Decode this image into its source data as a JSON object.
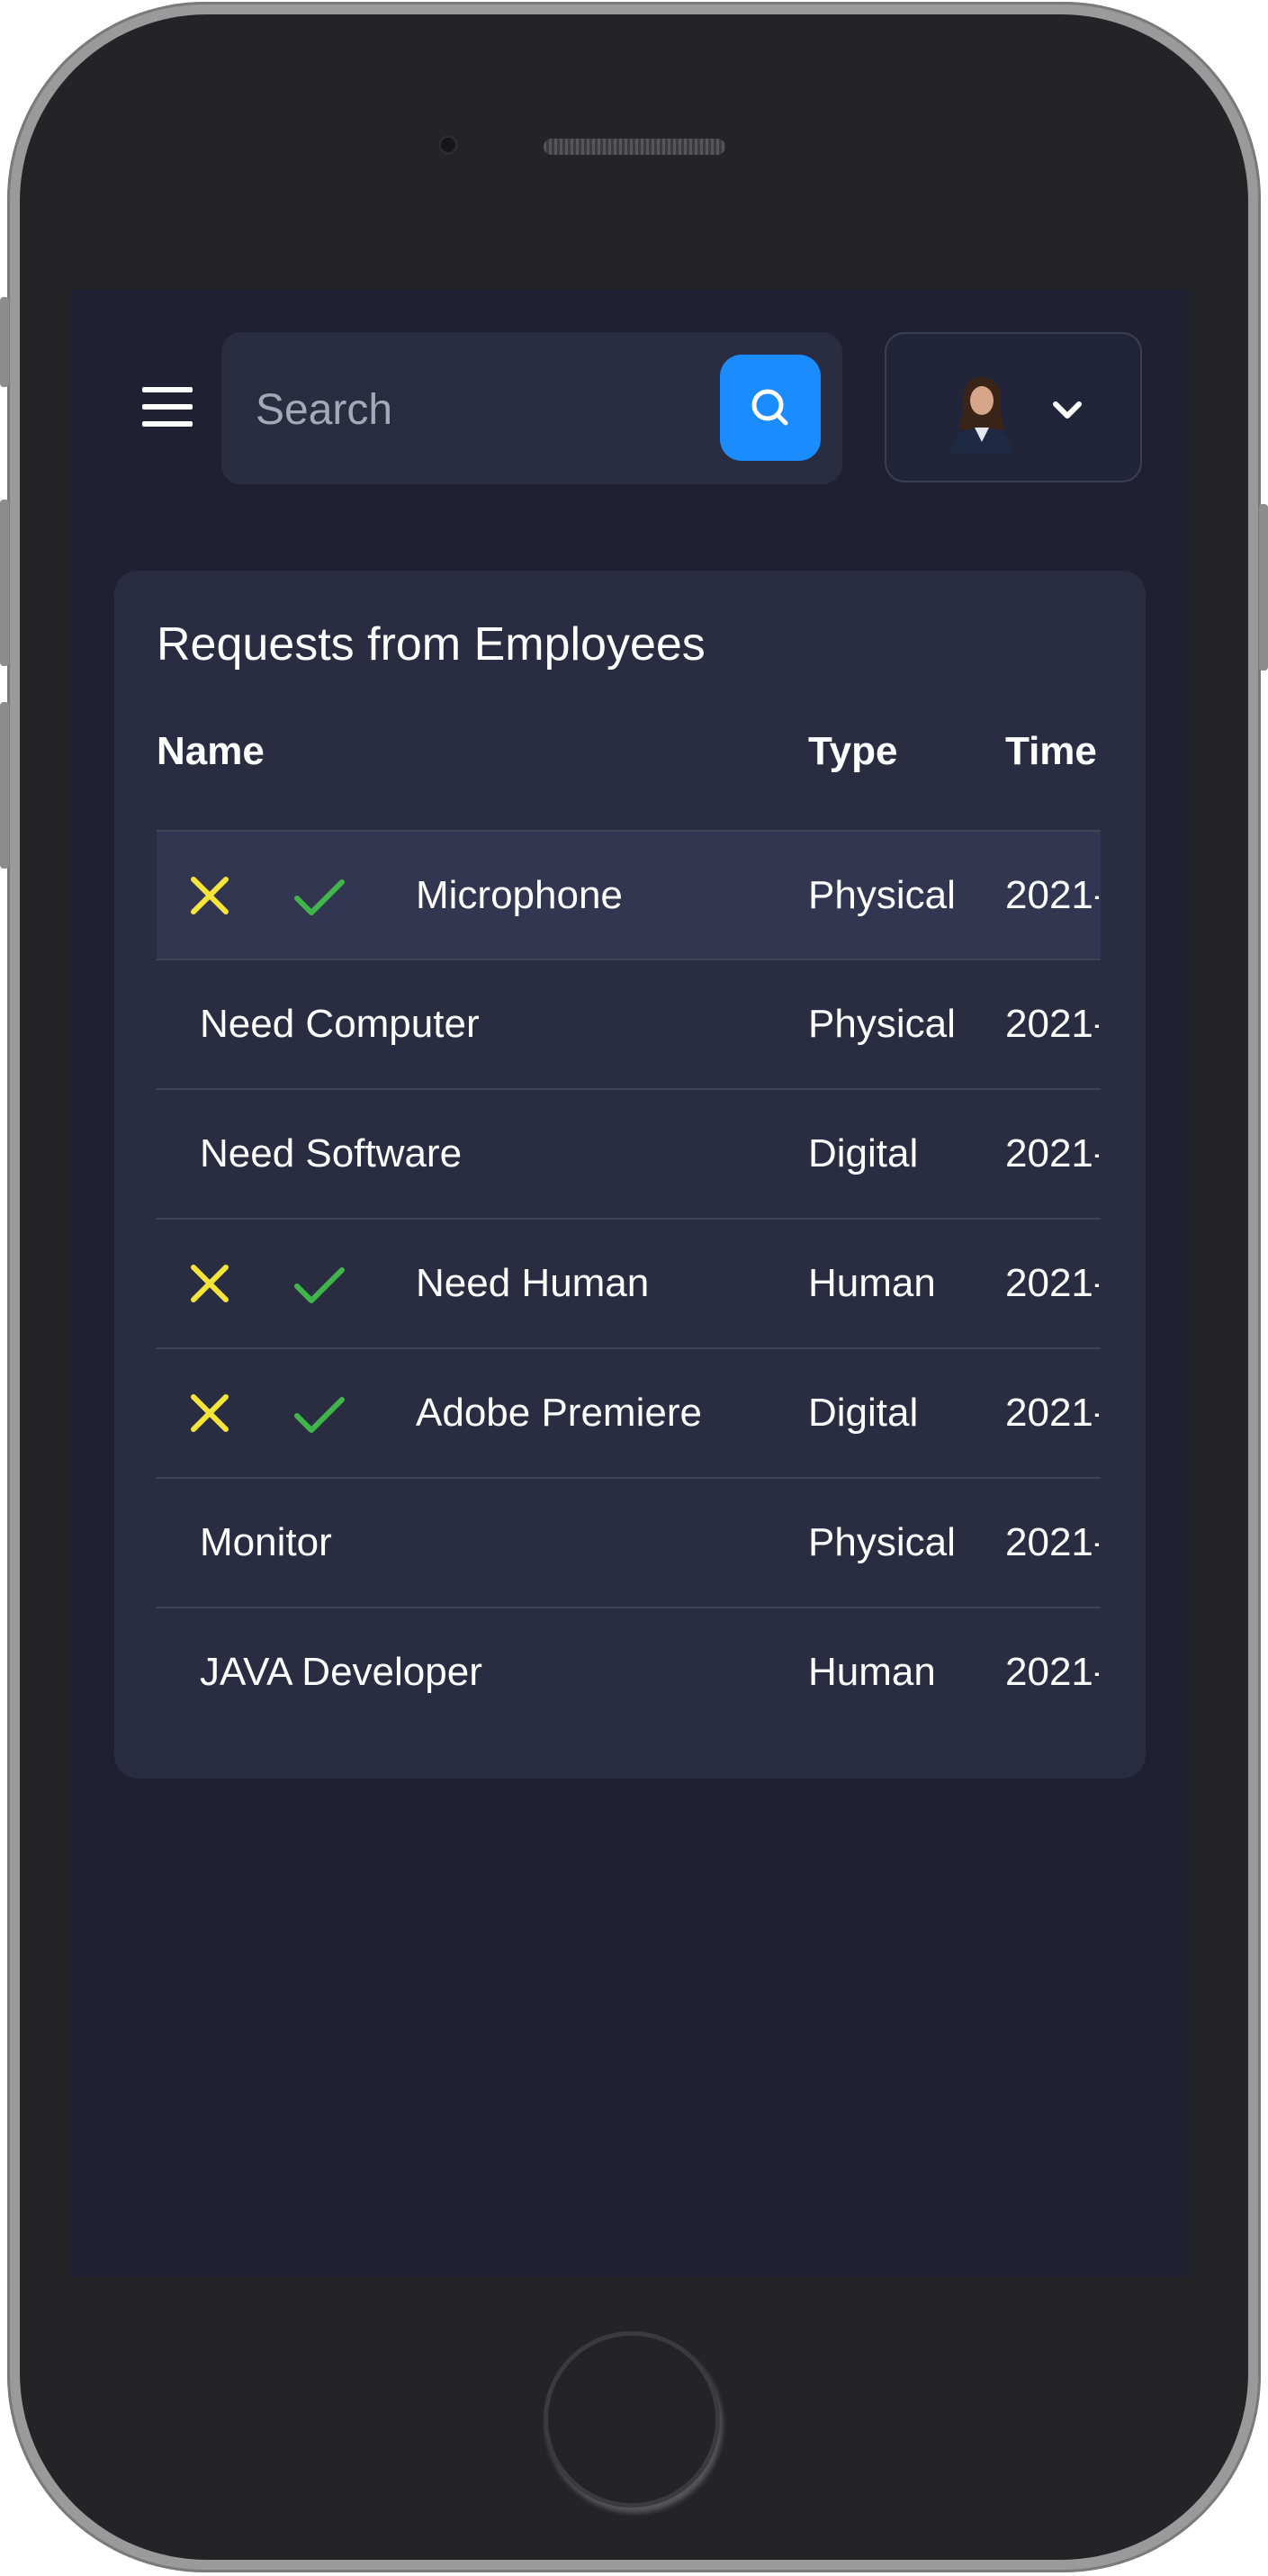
{
  "header": {
    "search_placeholder": "Search",
    "menu_icon": "hamburger-icon",
    "search_icon": "search-icon",
    "profile_dropdown_icon": "chevron-down-icon"
  },
  "card": {
    "title": "Requests from Employees",
    "columns": {
      "name": "Name",
      "type": "Type",
      "time": "Time"
    },
    "rows": [
      {
        "name": "Microphone",
        "type": "Physical",
        "time": "2021-",
        "has_actions": true
      },
      {
        "name": "Need Computer",
        "type": "Physical",
        "time": "2021-",
        "has_actions": false
      },
      {
        "name": "Need Software",
        "type": "Digital",
        "time": "2021-",
        "has_actions": false
      },
      {
        "name": "Need Human",
        "type": "Human",
        "time": "2021-",
        "has_actions": true
      },
      {
        "name": "Adobe Premiere",
        "type": "Digital",
        "time": "2021-",
        "has_actions": true
      },
      {
        "name": "Monitor",
        "type": "Physical",
        "time": "2021-",
        "has_actions": false
      },
      {
        "name": "JAVA Developer",
        "type": "Human",
        "time": "2021-",
        "has_actions": false
      }
    ]
  },
  "colors": {
    "screen_bg": "#1f2133",
    "card_bg": "#2a2d42",
    "accent": "#1a8cff",
    "reject": "#f5e53a",
    "approve": "#3fb54a"
  }
}
